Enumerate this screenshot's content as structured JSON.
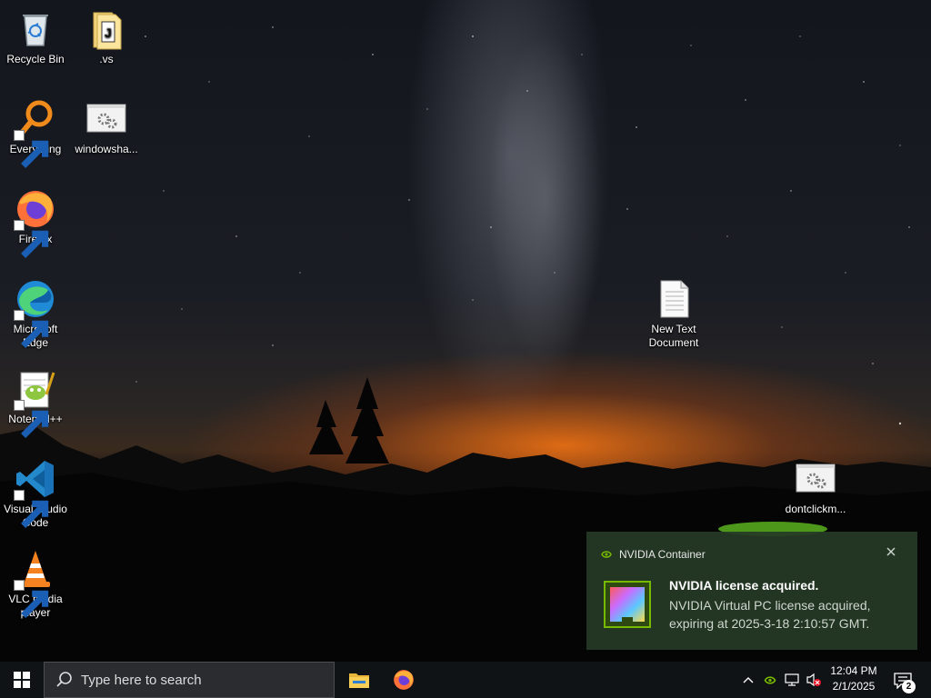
{
  "desktop": {
    "icons": [
      {
        "label": "Recycle Bin",
        "icon": "recycle-bin-icon"
      },
      {
        "label": ".vs",
        "icon": "folder-icon"
      },
      {
        "label": "Everything",
        "icon": "everything-search-icon"
      },
      {
        "label": "windowsha...",
        "icon": "settings-file-icon"
      },
      {
        "label": "Firefox",
        "icon": "firefox-icon"
      },
      {
        "label": "Microsoft Edge",
        "icon": "edge-icon"
      },
      {
        "label": "New Text Document",
        "icon": "text-document-icon"
      },
      {
        "label": "Notepad++",
        "icon": "notepad-plus-plus-icon"
      },
      {
        "label": "Visual Studio Code",
        "icon": "vscode-icon"
      },
      {
        "label": "dontclickm...",
        "icon": "settings-file-icon"
      },
      {
        "label": "VLC media player",
        "icon": "vlc-icon"
      }
    ]
  },
  "notification": {
    "app_name": "NVIDIA Container",
    "title": "NVIDIA license acquired.",
    "body": "NVIDIA Virtual PC license acquired, expiring at 2025-3-18 2:10:57 GMT.",
    "accent_color": "#76b900"
  },
  "taskbar": {
    "search_placeholder": "Type here to search",
    "pinned": [
      "file-explorer-icon",
      "firefox-icon"
    ],
    "tray": [
      "chevron-up-icon",
      "nvidia-icon",
      "network-icon",
      "volume-muted-icon"
    ],
    "time": "12:04 PM",
    "date": "2/1/2025",
    "notification_count": "2"
  }
}
